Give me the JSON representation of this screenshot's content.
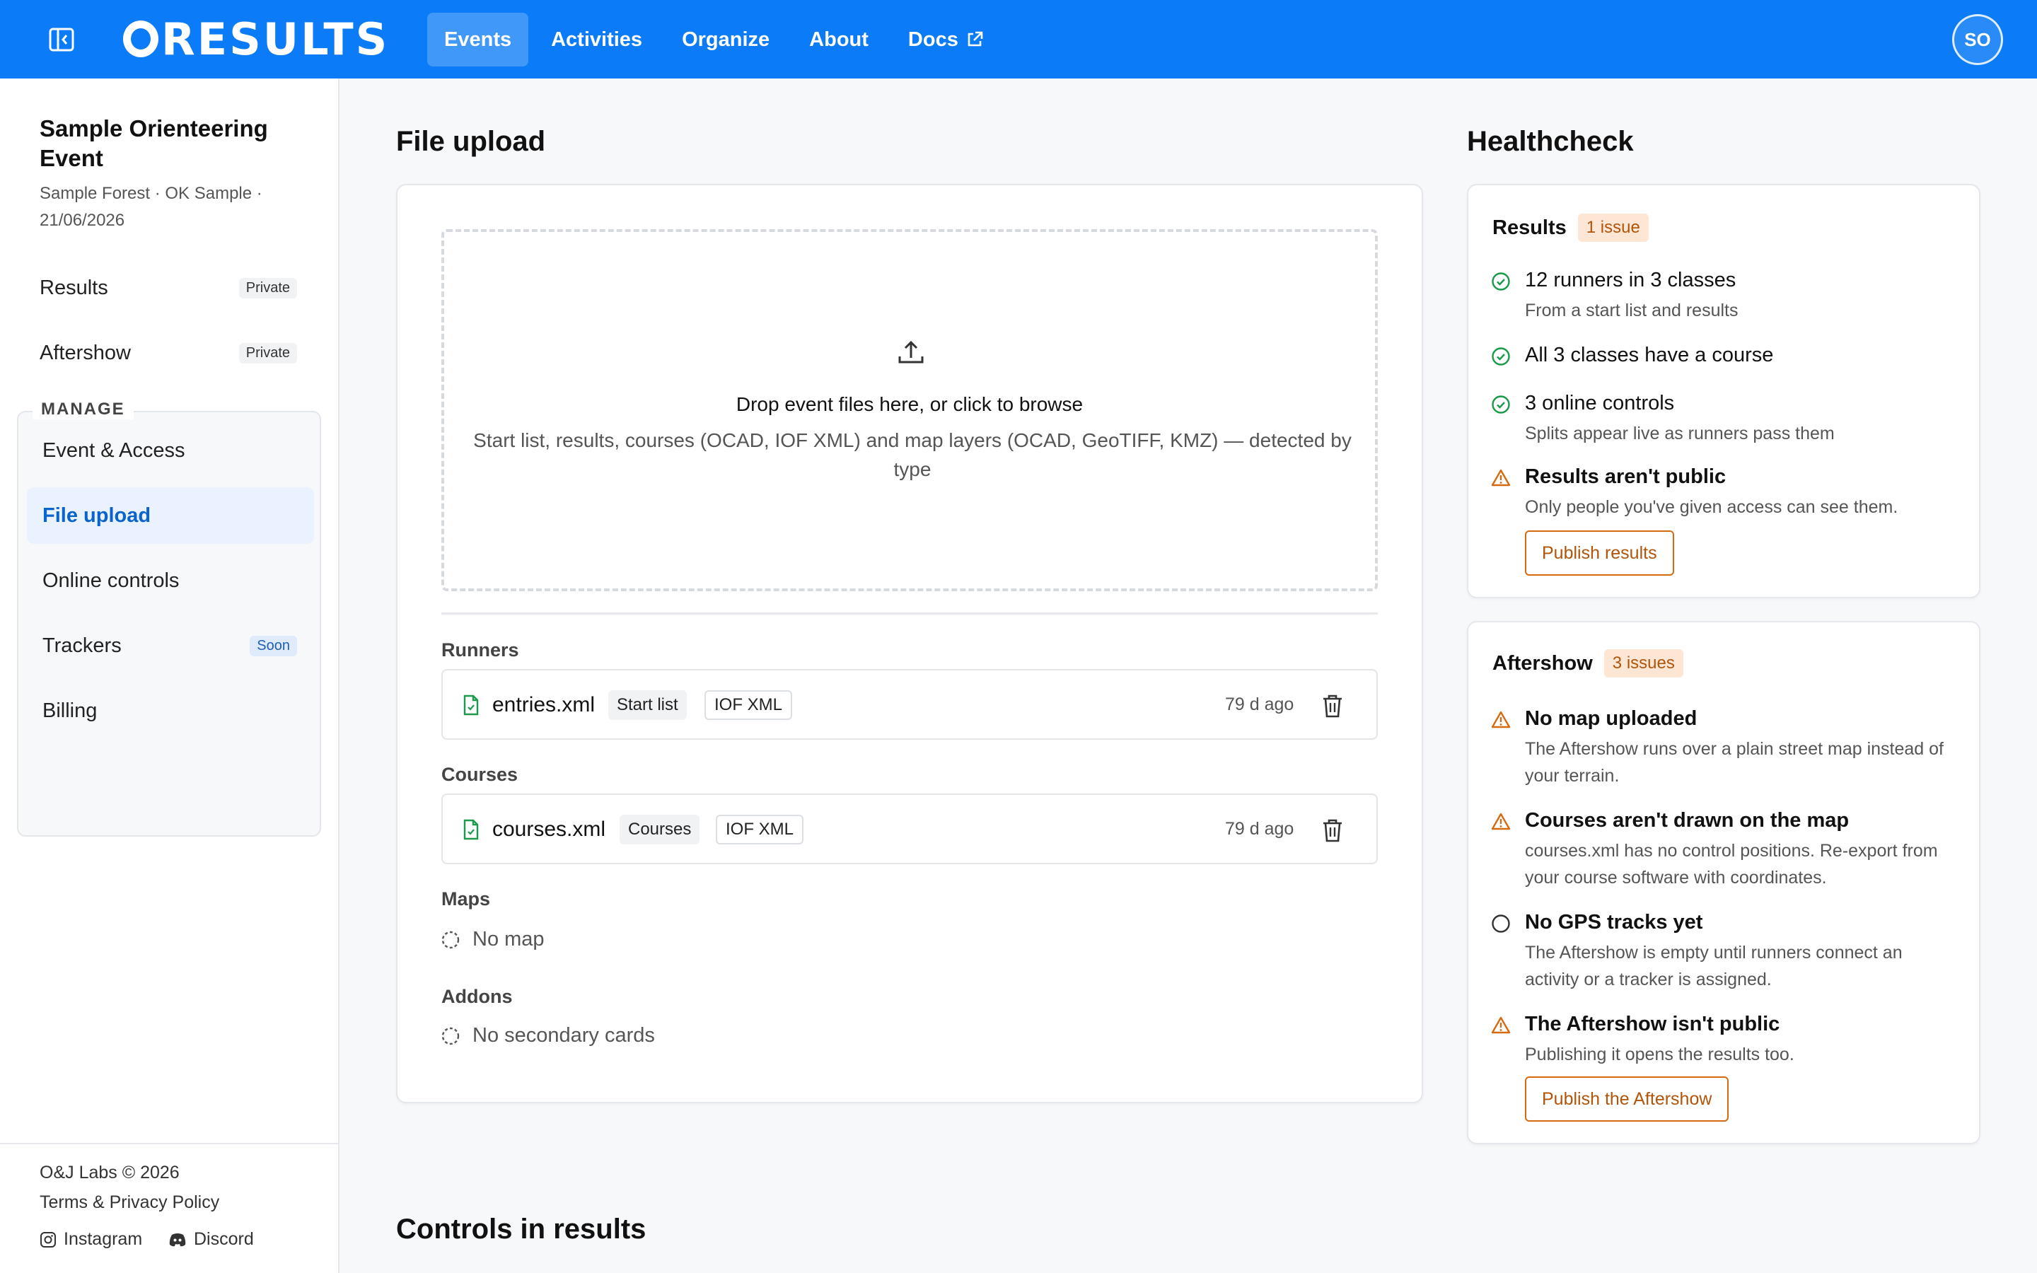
{
  "topbar": {
    "brand": "RESULTS",
    "nav": [
      {
        "label": "Events"
      },
      {
        "label": "Activities"
      },
      {
        "label": "Organize"
      },
      {
        "label": "About"
      },
      {
        "label": "Docs"
      }
    ],
    "avatar_initials": "SO",
    "accent_color": "#0b7bf7"
  },
  "sidebar": {
    "event_title": "Sample Orienteering Event",
    "event_subtitle": "Sample Forest · OK Sample · 21/06/2026",
    "links": [
      {
        "label": "Results",
        "badge": "Private"
      },
      {
        "label": "Aftershow",
        "badge": "Private"
      }
    ],
    "manage_label": "MANAGE",
    "manage_items": [
      {
        "label": "Event & Access"
      },
      {
        "label": "File upload"
      },
      {
        "label": "Online controls"
      },
      {
        "label": "Trackers",
        "badge": "Soon"
      },
      {
        "label": "Billing"
      }
    ],
    "footer": {
      "copyright": "O&J Labs © 2026",
      "terms": "Terms & Privacy Policy",
      "instagram": "Instagram",
      "discord": "Discord"
    }
  },
  "file_upload": {
    "heading": "File upload",
    "dropzone_title": "Drop event files here, or click to browse",
    "dropzone_sub": "Start list, results, courses (OCAD, IOF XML) and map layers (OCAD, GeoTIFF, KMZ) — detected by type",
    "runners_label": "Runners",
    "runners_file": {
      "name": "entries.xml",
      "tag1": "Start list",
      "tag2": "IOF XML",
      "age": "79 d ago"
    },
    "courses_label": "Courses",
    "courses_file": {
      "name": "courses.xml",
      "tag1": "Courses",
      "tag2": "IOF XML",
      "age": "79 d ago"
    },
    "maps_label": "Maps",
    "maps_empty": "No map",
    "addons_label": "Addons",
    "addons_empty": "No secondary cards"
  },
  "healthcheck": {
    "heading": "Healthcheck",
    "results": {
      "title": "Results",
      "badge": "1 issue",
      "items": [
        {
          "title": "12 runners in 3 classes",
          "desc": "From a start list and results"
        },
        {
          "title": "All 3 classes have a course",
          "desc": ""
        },
        {
          "title": "3 online controls",
          "desc": "Splits appear live as runners pass them"
        },
        {
          "title": "Results aren't public",
          "desc": "Only people you've given access can see them."
        }
      ],
      "button": "Publish results"
    },
    "aftershow": {
      "title": "Aftershow",
      "badge": "3 issues",
      "items": [
        {
          "title": "No map uploaded",
          "desc": "The Aftershow runs over a plain street map instead of your terrain."
        },
        {
          "title": "Courses aren't drawn on the map",
          "desc": "courses.xml has no control positions. Re-export from your course software with coordinates."
        },
        {
          "title": "No GPS tracks yet",
          "desc": "The Aftershow is empty until runners connect an activity or a tracker is assigned."
        },
        {
          "title": "The Aftershow isn't public",
          "desc": "Publishing it opens the results too."
        }
      ],
      "button": "Publish the Aftershow"
    }
  },
  "controls_heading": "Controls in results"
}
